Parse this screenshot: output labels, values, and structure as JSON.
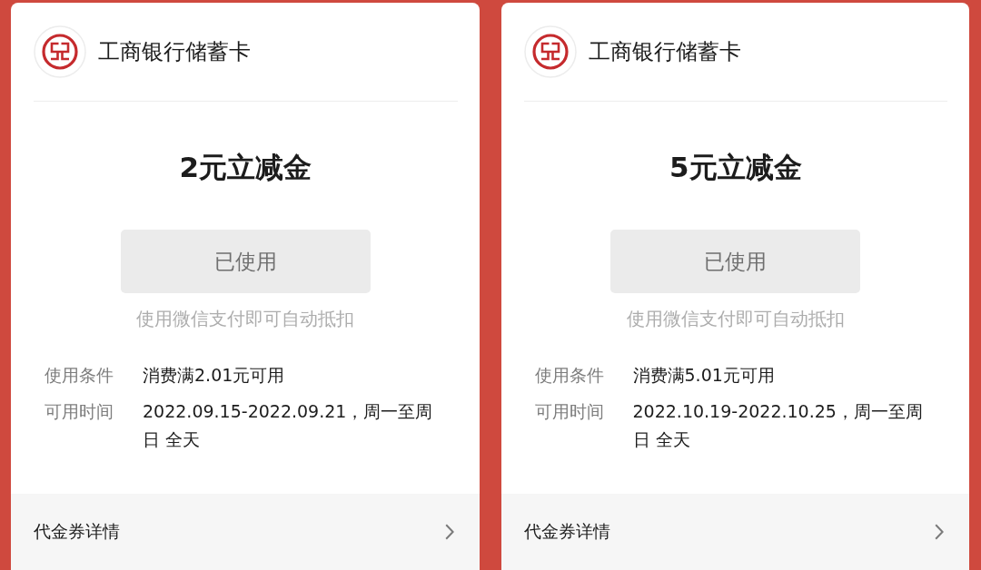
{
  "cards": [
    {
      "bank": "工商银行储蓄卡",
      "amount": "2元立减金",
      "button": {
        "label": "已使用",
        "disabled": true
      },
      "hint": "使用微信支付即可自动抵扣",
      "details": [
        {
          "label": "使用条件",
          "value": "消费满2.01元可用"
        },
        {
          "label": "可用时间",
          "value": "2022.09.15-2022.09.21，周一至周日 全天"
        }
      ],
      "footer": "代金券详情"
    },
    {
      "bank": "工商银行储蓄卡",
      "amount": "5元立减金",
      "button": {
        "label": "已使用",
        "disabled": true
      },
      "hint": "使用微信支付即可自动抵扣",
      "details": [
        {
          "label": "使用条件",
          "value": "消费满5.01元可用"
        },
        {
          "label": "可用时间",
          "value": "2022.10.19-2022.10.25，周一至周日 全天"
        }
      ],
      "footer": "代金券详情"
    }
  ]
}
